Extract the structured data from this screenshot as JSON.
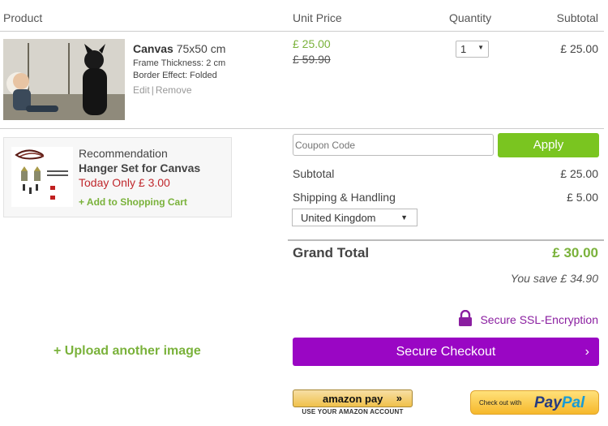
{
  "header": {
    "product": "Product",
    "unit_price": "Unit Price",
    "quantity": "Quantity",
    "subtotal": "Subtotal"
  },
  "item": {
    "name": "Canvas",
    "size": "75x50 cm",
    "frame": "Frame Thickness: 2 cm",
    "border": "Border Effect: Folded",
    "edit": "Edit",
    "separator": "|",
    "remove": "Remove",
    "price_now": "£ 25.00",
    "price_old": "£ 59.90",
    "qty": "1",
    "subtotal": "£ 25.00"
  },
  "recommendation": {
    "label": "Recommendation",
    "title": "Hanger Set for Canvas",
    "offer": "Today Only £ 3.00",
    "add": "+ Add to Shopping Cart"
  },
  "totals": {
    "coupon_placeholder": "Coupon Code",
    "apply": "Apply",
    "subtotal_label": "Subtotal",
    "subtotal_value": "£ 25.00",
    "shipping_label": "Shipping & Handling",
    "shipping_value": "£ 5.00",
    "country": "United Kingdom",
    "grand_label": "Grand Total",
    "grand_value": "£ 30.00",
    "save": "You save £ 34.90"
  },
  "secure": "Secure SSL-Encryption",
  "upload": "+ Upload another image",
  "checkout": "Secure Checkout",
  "amazon": {
    "logo": "amazon pay",
    "chevrons": "»",
    "sub": "USE YOUR AMAZON ACCOUNT"
  },
  "paypal": {
    "small": "Check out with",
    "pay": "Pay",
    "pal": "Pal"
  },
  "colors": {
    "green": "#7ab23b",
    "apply_green": "#7ac520",
    "purple": "#9a06c4",
    "offer_red": "#c0282d"
  }
}
